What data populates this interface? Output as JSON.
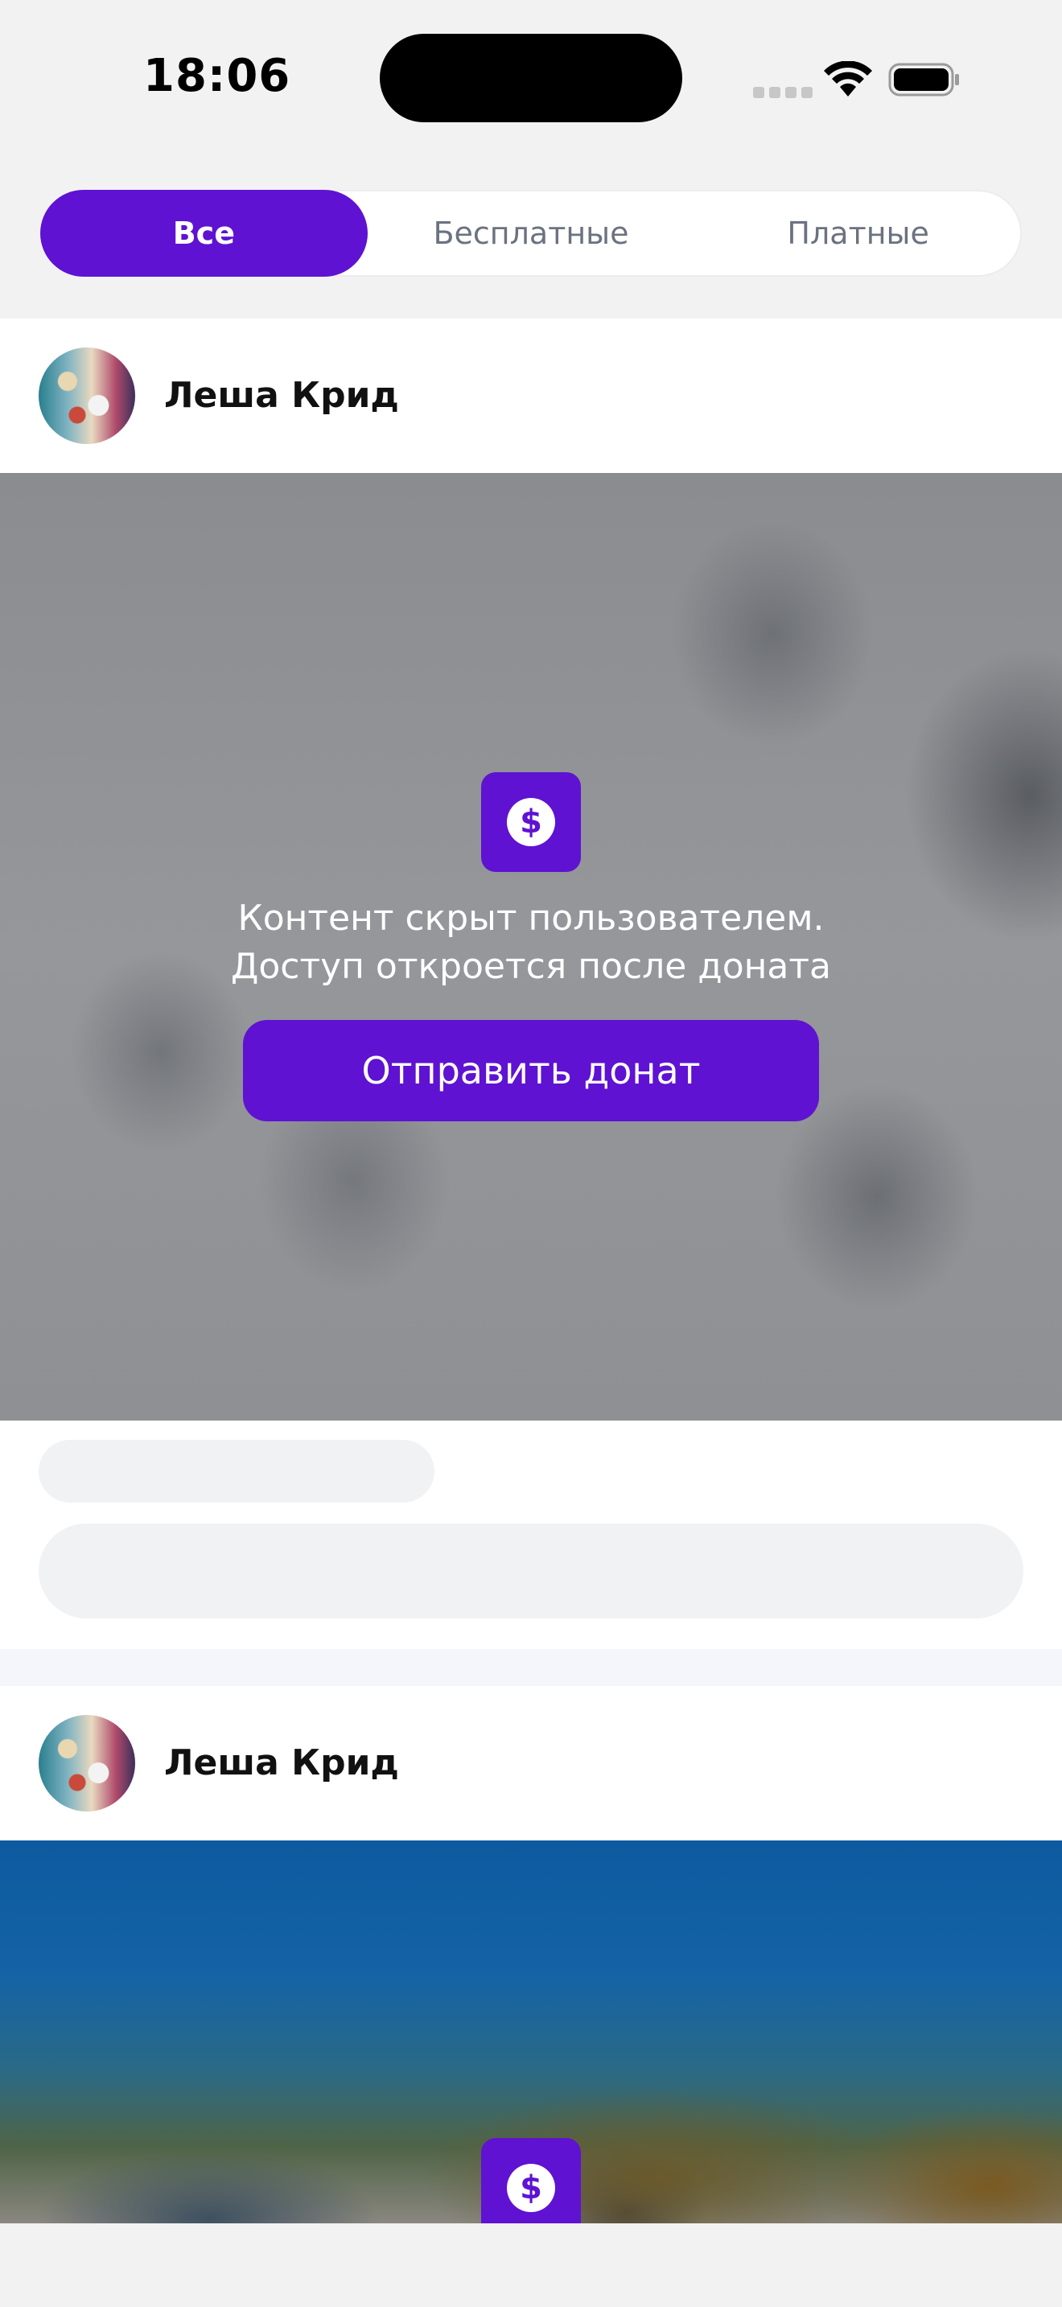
{
  "status_bar": {
    "time": "18:06"
  },
  "filter_tabs": [
    {
      "label": "Все",
      "active": true
    },
    {
      "label": "Бесплатные",
      "active": false
    },
    {
      "label": "Платные",
      "active": false
    }
  ],
  "posts": [
    {
      "author": "Леша Крид",
      "locked": {
        "icon": "dollar-icon",
        "symbol": "$",
        "message_line1": "Контент скрыт пользователем.",
        "message_line2": "Доступ откроется после доната",
        "donate_button": "Отправить донат"
      }
    },
    {
      "author": "Леша Крид",
      "locked": {
        "icon": "dollar-icon",
        "symbol": "$"
      }
    }
  ],
  "colors": {
    "accent": "#5f12d2",
    "background": "#f2f2f2",
    "skeleton": "#f1f2f4"
  }
}
